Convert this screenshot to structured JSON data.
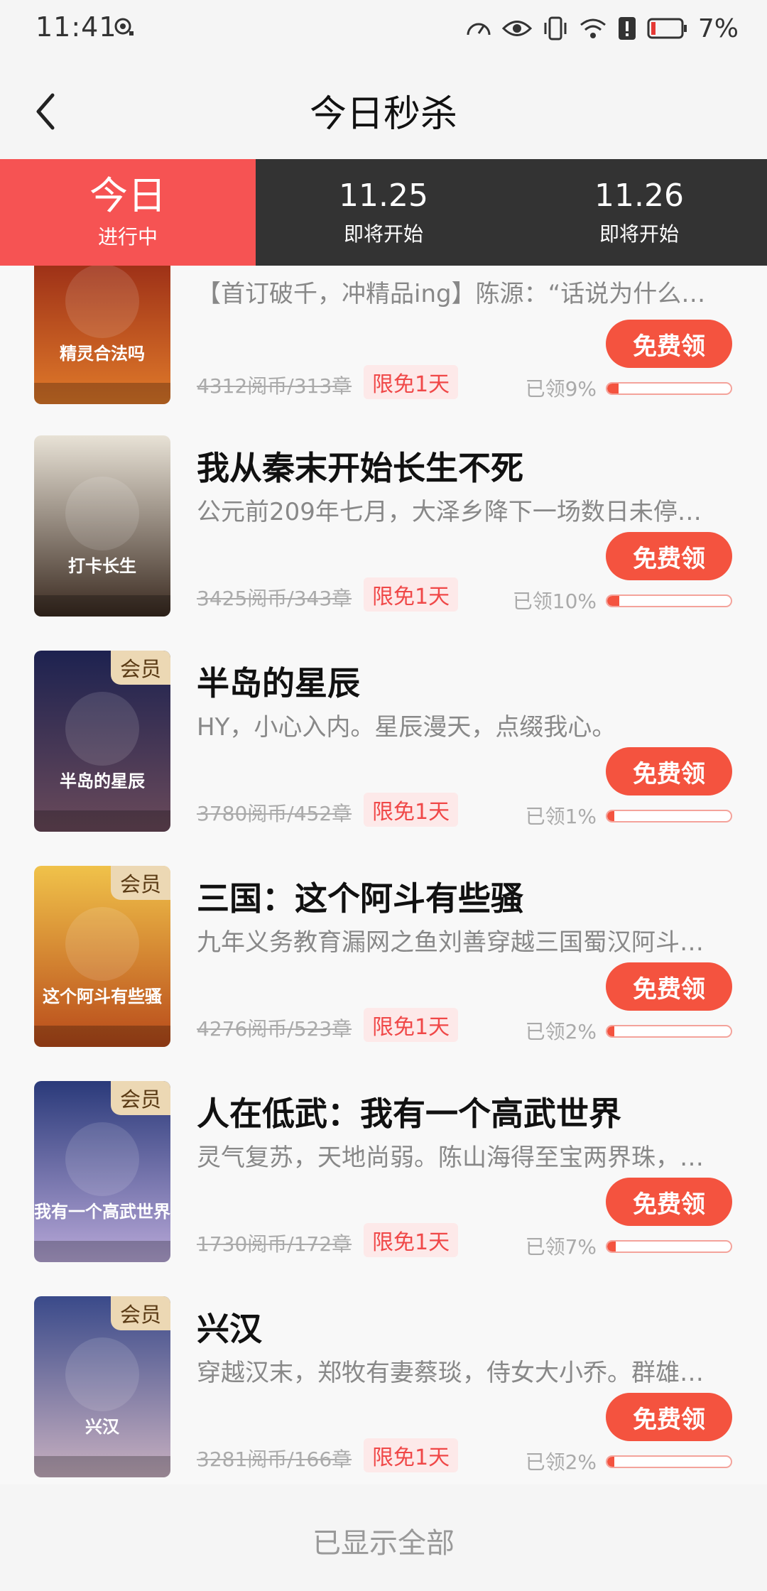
{
  "status_bar": {
    "time": "11:41",
    "battery_percent": "7%"
  },
  "header": {
    "title": "今日秒杀"
  },
  "tabs": [
    {
      "main": "今日",
      "sub": "进行中",
      "active": true
    },
    {
      "main": "11.25",
      "sub": "即将开始",
      "active": false
    },
    {
      "main": "11.26",
      "sub": "即将开始",
      "active": false
    }
  ],
  "books": [
    {
      "title": "",
      "desc": "【首订破千，冲精品ing】陈源：“话说为什么…",
      "price": "4312阅币/313章",
      "tag": "限免1天",
      "button": "免费领",
      "claimed": "已领9%",
      "progress": 0.09,
      "vip": "",
      "cover_text": "精灵合法吗",
      "cover_colors": [
        "#8a1b12",
        "#e07a2a"
      ]
    },
    {
      "title": "我从秦末开始长生不死",
      "desc": "公元前209年七月，大泽乡降下一场数日未停…",
      "price": "3425阅币/343章",
      "tag": "限免1天",
      "button": "免费领",
      "claimed": "已领10%",
      "progress": 0.1,
      "vip": "",
      "cover_text": "打卡长生",
      "cover_colors": [
        "#e8e2d6",
        "#3a2a20"
      ]
    },
    {
      "title": "半岛的星辰",
      "desc": "HY，小心入内。星辰漫天，点缀我心。",
      "price": "3780阅币/452章",
      "tag": "限免1天",
      "button": "免费领",
      "claimed": "已领1%",
      "progress": 0.01,
      "vip": "会员",
      "cover_text": "半岛的星辰",
      "cover_colors": [
        "#1d2250",
        "#6a4a5a"
      ]
    },
    {
      "title": "三国：这个阿斗有些骚",
      "desc": "九年义务教育漏网之鱼刘善穿越三国蜀汉阿斗…",
      "price": "4276阅币/523章",
      "tag": "限免1天",
      "button": "免费领",
      "claimed": "已领2%",
      "progress": 0.02,
      "vip": "会员",
      "cover_text": "这个阿斗有些骚",
      "cover_colors": [
        "#f0c24a",
        "#b84a1a"
      ]
    },
    {
      "title": "人在低武：我有一个高武世界",
      "desc": "灵气复苏，天地尚弱。陈山海得至宝两界珠，…",
      "price": "1730阅币/172章",
      "tag": "限免1天",
      "button": "免费领",
      "claimed": "已领7%",
      "progress": 0.07,
      "vip": "会员",
      "cover_text": "我有一个高武世界",
      "cover_colors": [
        "#2a3a7a",
        "#b8a8d8"
      ]
    },
    {
      "title": "兴汉",
      "desc": "穿越汉末，郑牧有妻蔡琰，侍女大小乔。群雄…",
      "price": "3281阅币/166章",
      "tag": "限免1天",
      "button": "免费领",
      "claimed": "已领2%",
      "progress": 0.02,
      "vip": "会员",
      "cover_text": "兴汉",
      "cover_colors": [
        "#3a4a8a",
        "#c8b0c0"
      ]
    }
  ],
  "footer": {
    "text": "已显示全部"
  }
}
